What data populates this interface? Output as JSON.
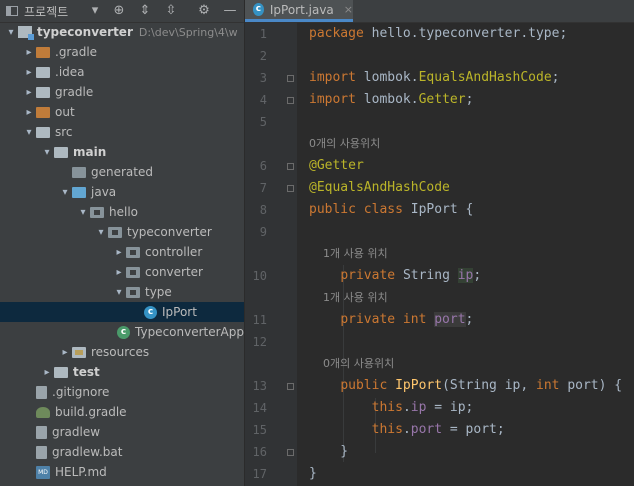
{
  "project_panel": {
    "title": "프로젝트",
    "icons": [
      "dropdown-arrow-icon",
      "locate-icon",
      "expand-all-icon",
      "collapse-all-icon",
      "gear-icon",
      "minimize-icon"
    ]
  },
  "tree": [
    {
      "depth": 0,
      "arrow": "down",
      "icon": "module",
      "label": "typeconverter",
      "bold": true,
      "extra": "D:\\dev\\Spring\\4\\w"
    },
    {
      "depth": 1,
      "arrow": "right",
      "icon": "folder-orange",
      "label": ".gradle"
    },
    {
      "depth": 1,
      "arrow": "right",
      "icon": "folder",
      "label": ".idea"
    },
    {
      "depth": 1,
      "arrow": "right",
      "icon": "folder",
      "label": "gradle"
    },
    {
      "depth": 1,
      "arrow": "right",
      "icon": "folder-orange",
      "label": "out"
    },
    {
      "depth": 1,
      "arrow": "down",
      "icon": "folder",
      "label": "src"
    },
    {
      "depth": 2,
      "arrow": "down",
      "icon": "folder",
      "label": "main",
      "bold": true
    },
    {
      "depth": 3,
      "arrow": "none",
      "icon": "folder-gen",
      "label": "generated"
    },
    {
      "depth": 3,
      "arrow": "down",
      "icon": "folder-blue",
      "label": "java"
    },
    {
      "depth": 4,
      "arrow": "down",
      "icon": "package",
      "label": "hello"
    },
    {
      "depth": 5,
      "arrow": "down",
      "icon": "package",
      "label": "typeconverter"
    },
    {
      "depth": 6,
      "arrow": "right",
      "icon": "package",
      "label": "controller"
    },
    {
      "depth": 6,
      "arrow": "right",
      "icon": "package",
      "label": "converter"
    },
    {
      "depth": 6,
      "arrow": "down",
      "icon": "package",
      "label": "type"
    },
    {
      "depth": 7,
      "arrow": "none",
      "icon": "class",
      "label": "IpPort",
      "selected": true
    },
    {
      "depth": 6,
      "arrow": "none",
      "icon": "class-spring",
      "label": "TypeconverterApp"
    },
    {
      "depth": 3,
      "arrow": "right",
      "icon": "folder-res",
      "label": "resources"
    },
    {
      "depth": 2,
      "arrow": "right",
      "icon": "folder",
      "label": "test",
      "bold": true
    },
    {
      "depth": 1,
      "arrow": "none",
      "icon": "file",
      "label": ".gitignore"
    },
    {
      "depth": 1,
      "arrow": "none",
      "icon": "gradle",
      "label": "build.gradle"
    },
    {
      "depth": 1,
      "arrow": "none",
      "icon": "file",
      "label": "gradlew"
    },
    {
      "depth": 1,
      "arrow": "none",
      "icon": "file",
      "label": "gradlew.bat"
    },
    {
      "depth": 1,
      "arrow": "none",
      "icon": "md",
      "label": "HELP.md"
    }
  ],
  "editor": {
    "tab_label": "IpPort.java",
    "tab_close": "×",
    "lines": [
      {
        "num": "1",
        "parts": [
          [
            "kw",
            "package "
          ],
          [
            "",
            "hello.typeconverter.type;"
          ]
        ]
      },
      {
        "num": "2",
        "parts": []
      },
      {
        "num": "3",
        "parts": [
          [
            "kw",
            "import "
          ],
          [
            "",
            "lombok."
          ],
          [
            "ann",
            "EqualsAndHashCode"
          ],
          [
            "",
            ";"
          ]
        ],
        "fold": true
      },
      {
        "num": "4",
        "parts": [
          [
            "kw",
            "import "
          ],
          [
            "",
            "lombok."
          ],
          [
            "ann",
            "Getter"
          ],
          [
            "",
            ";"
          ]
        ],
        "fold": true
      },
      {
        "num": "5",
        "parts": []
      },
      {
        "num": "",
        "hint": "0개의 사용위치"
      },
      {
        "num": "6",
        "parts": [
          [
            "ann",
            "@Getter"
          ]
        ],
        "fold": true
      },
      {
        "num": "7",
        "parts": [
          [
            "ann",
            "@EqualsAndHashCode"
          ]
        ],
        "fold": true
      },
      {
        "num": "8",
        "parts": [
          [
            "kw",
            "public class "
          ],
          [
            "",
            "IpPort {"
          ]
        ]
      },
      {
        "num": "9",
        "parts": []
      },
      {
        "num": "",
        "hint": "    1개 사용 위치"
      },
      {
        "num": "10",
        "parts": [
          [
            "",
            "    "
          ],
          [
            "kw",
            "private "
          ],
          [
            "",
            "String "
          ],
          [
            "fld hl",
            "ip"
          ],
          [
            "",
            ";"
          ]
        ]
      },
      {
        "num": "",
        "hint": "    1개 사용 위치"
      },
      {
        "num": "11",
        "parts": [
          [
            "",
            "    "
          ],
          [
            "kw",
            "private int "
          ],
          [
            "fld hl2",
            "port"
          ],
          [
            "",
            ";"
          ]
        ]
      },
      {
        "num": "12",
        "parts": []
      },
      {
        "num": "",
        "hint": "    0개의 사용위치"
      },
      {
        "num": "13",
        "parts": [
          [
            "",
            "    "
          ],
          [
            "kw",
            "public "
          ],
          [
            "fn",
            "IpPort"
          ],
          [
            "",
            "(String ip, "
          ],
          [
            "kw",
            "int "
          ],
          [
            "",
            "port) {"
          ]
        ],
        "fold": true
      },
      {
        "num": "14",
        "parts": [
          [
            "",
            "        "
          ],
          [
            "kw",
            "this"
          ],
          [
            "",
            "."
          ],
          [
            "fld",
            "ip"
          ],
          [
            "",
            " = ip;"
          ]
        ]
      },
      {
        "num": "15",
        "parts": [
          [
            "",
            "        "
          ],
          [
            "kw",
            "this"
          ],
          [
            "",
            "."
          ],
          [
            "fld",
            "port"
          ],
          [
            "",
            " = port;"
          ]
        ]
      },
      {
        "num": "16",
        "parts": [
          [
            "",
            "    }"
          ]
        ],
        "fold": true
      },
      {
        "num": "17",
        "parts": [
          [
            "",
            "}"
          ]
        ]
      }
    ]
  }
}
